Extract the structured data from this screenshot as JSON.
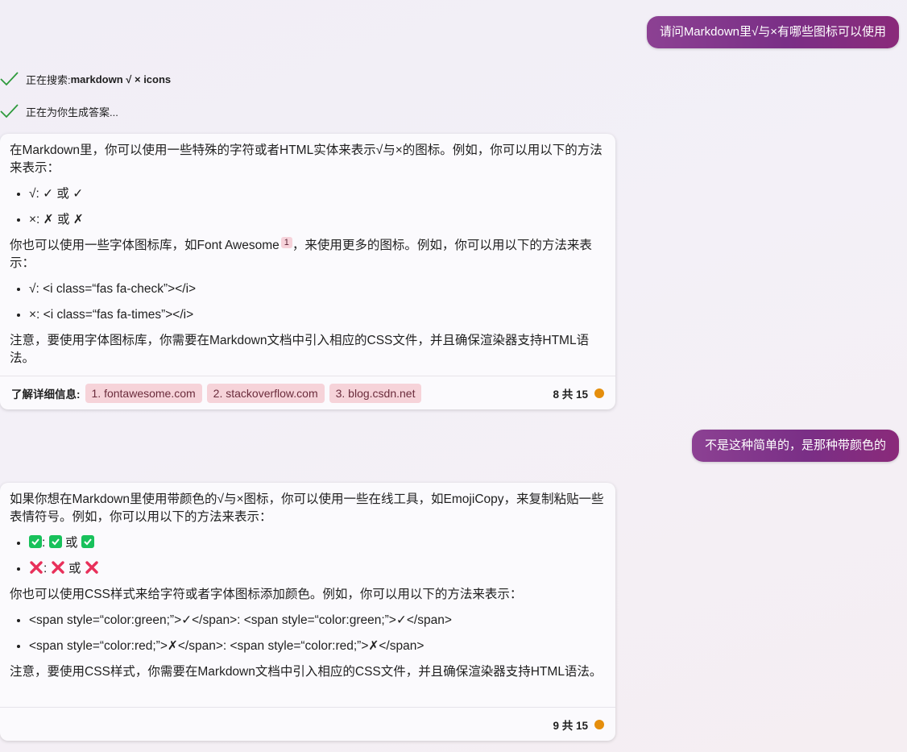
{
  "messages": {
    "user1": "请问Markdown里√与×有哪些图标可以使用",
    "user2": "不是这种简单的，是那种带颜色的"
  },
  "status": {
    "searching_prefix": "正在搜索: ",
    "search_query": "markdown √ × icons",
    "generating": "正在为你生成答案..."
  },
  "card1": {
    "p1": "在Markdown里，你可以使用一些特殊的字符或者HTML实体来表示√与×的图标。例如，你可以用以下的方法来表示：",
    "li1": "√: ✓ 或 ✓",
    "li2": "×: ✗ 或 ✗",
    "p2_before": "你也可以使用一些字体图标库，如Font Awesome",
    "p2_ref": "1",
    "p2_after": "，来使用更多的图标。例如，你可以用以下的方法来表示：",
    "li3": "√: <i class=“fas fa-check”></i>",
    "li4": "×: <i class=“fas fa-times”></i>",
    "p3": "注意，要使用字体图标库，你需要在Markdown文档中引入相应的CSS文件，并且确保渲染器支持HTML语法。",
    "learn_more": "了解详细信息:",
    "sources": [
      "1. fontawesome.com",
      "2. stackoverflow.com",
      "3. blog.csdn.net"
    ],
    "counter": "8 共 15"
  },
  "card2": {
    "p1": "如果你想在Markdown里使用带颜色的√与×图标，你可以使用一些在线工具，如EmojiCopy，来复制粘贴一些表情符号。例如，你可以用以下的方法来表示：",
    "li1_sep": ":",
    "li1_or": "或",
    "li2_sep": ":",
    "li2_or": "或",
    "p2": "你也可以使用CSS样式来给字符或者字体图标添加颜色。例如，你可以用以下的方法来表示：",
    "li3": "<span style=“color:green;”>✓</span>: <span style=“color:green;”>✓</span>",
    "li4": "<span style=“color:red;”>✗</span>: <span style=“color:red;”>✗</span>",
    "p3": "注意，要使用CSS样式，你需要在Markdown文档中引入相应的CSS文件，并且确保渲染器支持HTML语法。",
    "counter": "9 共 15"
  },
  "colors": {
    "user_bubble": "#7a2f86",
    "source_chip": "#f6d3d9",
    "status_dot": "#e58e0c",
    "check_green": "#18c15b",
    "cross_red": "#e8305a",
    "status_check": "#2e9a3c"
  },
  "icons": {
    "status": "checkmark-icon",
    "emoji_check": "check-mark-button-emoji-icon",
    "emoji_cross": "cross-mark-emoji-icon",
    "dot": "status-dot-icon"
  }
}
